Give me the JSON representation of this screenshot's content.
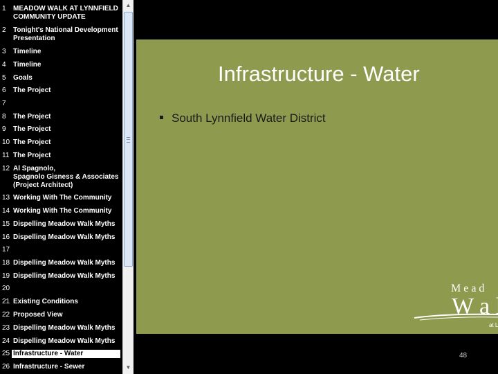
{
  "outline": {
    "items": [
      {
        "num": "1",
        "title": "MEADOW WALK AT LYNNFIELD\nCOMMUNITY UPDATE"
      },
      {
        "num": "2",
        "title": "Tonight's National Development\nPresentation"
      },
      {
        "num": "3",
        "title": "Timeline"
      },
      {
        "num": "4",
        "title": "Timeline"
      },
      {
        "num": "5",
        "title": "Goals"
      },
      {
        "num": "6",
        "title": "The Project"
      },
      {
        "num": "7",
        "title": ""
      },
      {
        "num": "8",
        "title": "The Project"
      },
      {
        "num": "9",
        "title": "The Project"
      },
      {
        "num": "10",
        "title": "The Project"
      },
      {
        "num": "11",
        "title": "The Project"
      },
      {
        "num": "12",
        "title": "Al Spagnolo,\nSpagnolo Gisness & Associates\n(Project Architect)"
      },
      {
        "num": "13",
        "title": "Working With The Community"
      },
      {
        "num": "14",
        "title": "Working With The Community"
      },
      {
        "num": "15",
        "title": "Dispelling Meadow Walk Myths"
      },
      {
        "num": "16",
        "title": "Dispelling Meadow Walk Myths"
      },
      {
        "num": "17",
        "title": ""
      },
      {
        "num": "18",
        "title": "Dispelling Meadow Walk Myths"
      },
      {
        "num": "19",
        "title": "Dispelling Meadow Walk Myths"
      },
      {
        "num": "20",
        "title": ""
      },
      {
        "num": "21",
        "title": "Existing Conditions"
      },
      {
        "num": "22",
        "title": "Proposed View"
      },
      {
        "num": "23",
        "title": "Dispelling Meadow Walk Myths"
      },
      {
        "num": "24",
        "title": "Dispelling Meadow Walk Myths"
      },
      {
        "num": "25",
        "title": "Infrastructure - Water"
      },
      {
        "num": "26",
        "title": "Infrastructure - Sewer"
      }
    ],
    "selected_num": "25"
  },
  "slide": {
    "title": "Infrastructure - Water",
    "bullets": [
      "South Lynnfield Water District"
    ],
    "logo": {
      "line1": "M e a d",
      "line2": "W a l",
      "line3": "at L"
    },
    "page_number": "48"
  },
  "colors": {
    "slide_background": "#8e9b4e",
    "title_text": "#ffffff",
    "body_text": "#1a1a1a",
    "outline_background": "#000000",
    "outline_text": "#ffffff"
  },
  "icons": {
    "scroll_up": "scroll-up-arrow-icon",
    "scroll_down": "scroll-down-arrow-icon",
    "bullet": "square-bullet-icon"
  }
}
